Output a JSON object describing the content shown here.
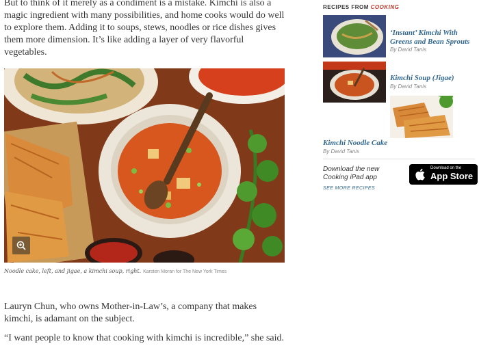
{
  "article": {
    "intro": "But to think of it merely as a condiment is a mistake. Kimchi is also a magic ingredient with many possibilities, and home cooks would do well to explore them. Adding it to soups, stews, noodles or rice dishes gives them more dimension. It’s like adding a layer of very flavorful vegetables.",
    "caption": "Noodle cake, left, and jigae, a kimchi soup, right.",
    "credit": "Karsten Moran for The New York Times",
    "para_lauryn": "Lauryn Chun, who owns Mother-in-Law’s, a company that makes kimchi, is adamant on the subject.",
    "para_quote": "“I want people to know that cooking with kimchi is incredible,” she said."
  },
  "sidebar": {
    "heading_prefix": "RECIPES FROM",
    "heading_brand": "COOKING",
    "recipes": [
      {
        "title": "‘Instant’ Kimchi With Greens and Bean Sprouts",
        "author": "By David Tanis"
      },
      {
        "title": "Kimchi Soup (Jigae)",
        "author": "By David Tanis"
      },
      {
        "title": "Kimchi Noodle Cake",
        "author": "By David Tanis"
      }
    ],
    "ipad_text": "Download the new Cooking iPad app",
    "see_more": "SEE MORE RECIPES",
    "appstore_small": "Download on the",
    "appstore_big": "App Store"
  },
  "colors": {
    "link": "#326891",
    "brand_red": "#c0392b"
  },
  "icons": {
    "zoom": "zoom-in-icon",
    "apple": "apple-icon"
  }
}
